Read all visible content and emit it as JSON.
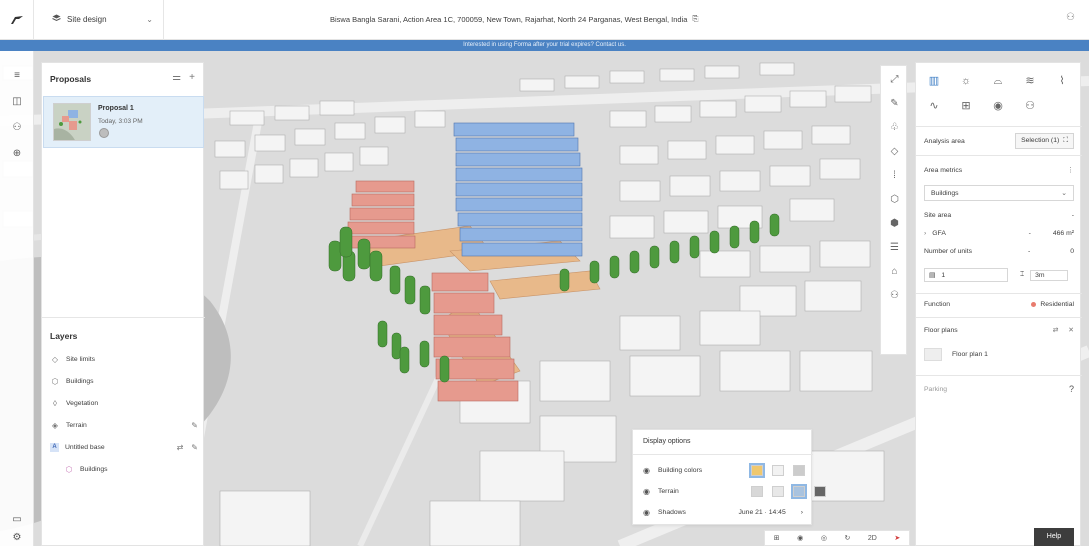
{
  "topbar": {
    "site_label": "Site design",
    "address": "Biswa Bangla Sarani, Action Area 1C, 700059, New Town, Rajarhat, North 24 Parganas, West Bengal, India"
  },
  "banner": {
    "text": "Interested in using Forma after your trial expires? Contact us."
  },
  "proposals": {
    "title": "Proposals",
    "items": [
      {
        "name": "Proposal 1",
        "date": "Today, 3:03 PM"
      }
    ]
  },
  "layers": {
    "title": "Layers",
    "items": [
      {
        "label": "Site limits",
        "icon": "site-limits-icon"
      },
      {
        "label": "Buildings",
        "icon": "buildings-icon"
      },
      {
        "label": "Vegetation",
        "icon": "vegetation-icon"
      },
      {
        "label": "Terrain",
        "icon": "terrain-icon"
      },
      {
        "label": "Untitled base",
        "icon": "base-icon",
        "badge": "A"
      },
      {
        "label": "Buildings",
        "icon": "buildings-icon"
      }
    ]
  },
  "right_panel": {
    "analysis_area_label": "Analysis area",
    "selection_label": "Selection (1)",
    "area_metrics_title": "Area metrics",
    "metrics_dropdown": "Buildings",
    "site_area_label": "Site area",
    "site_area_value": "-",
    "gfa_label": "GFA",
    "gfa_dash": "-",
    "gfa_value": "466 m²",
    "units_label": "Number of units",
    "units_dash": "-",
    "units_value": "0",
    "floors_value": "1",
    "floor_height_value": "3m",
    "function_label": "Function",
    "function_value": "Residential",
    "floor_plans_title": "Floor plans",
    "floor_plan_item": "Floor plan 1",
    "parking_label": "Parking"
  },
  "display_options": {
    "title": "Display options",
    "rows": [
      {
        "label": "Building colors"
      },
      {
        "label": "Terrain"
      },
      {
        "label": "Shadows",
        "value": "June 21 · 14:45"
      }
    ]
  },
  "bottombar": {
    "mode_2d": "2D"
  },
  "help": {
    "label": "Help"
  },
  "colors": {
    "accent": "#4a82c3",
    "building_blue": "#8fb3e3",
    "building_red": "#e69a8e",
    "path_orange": "#e8b98a",
    "tree_green": "#4e9a3e"
  }
}
